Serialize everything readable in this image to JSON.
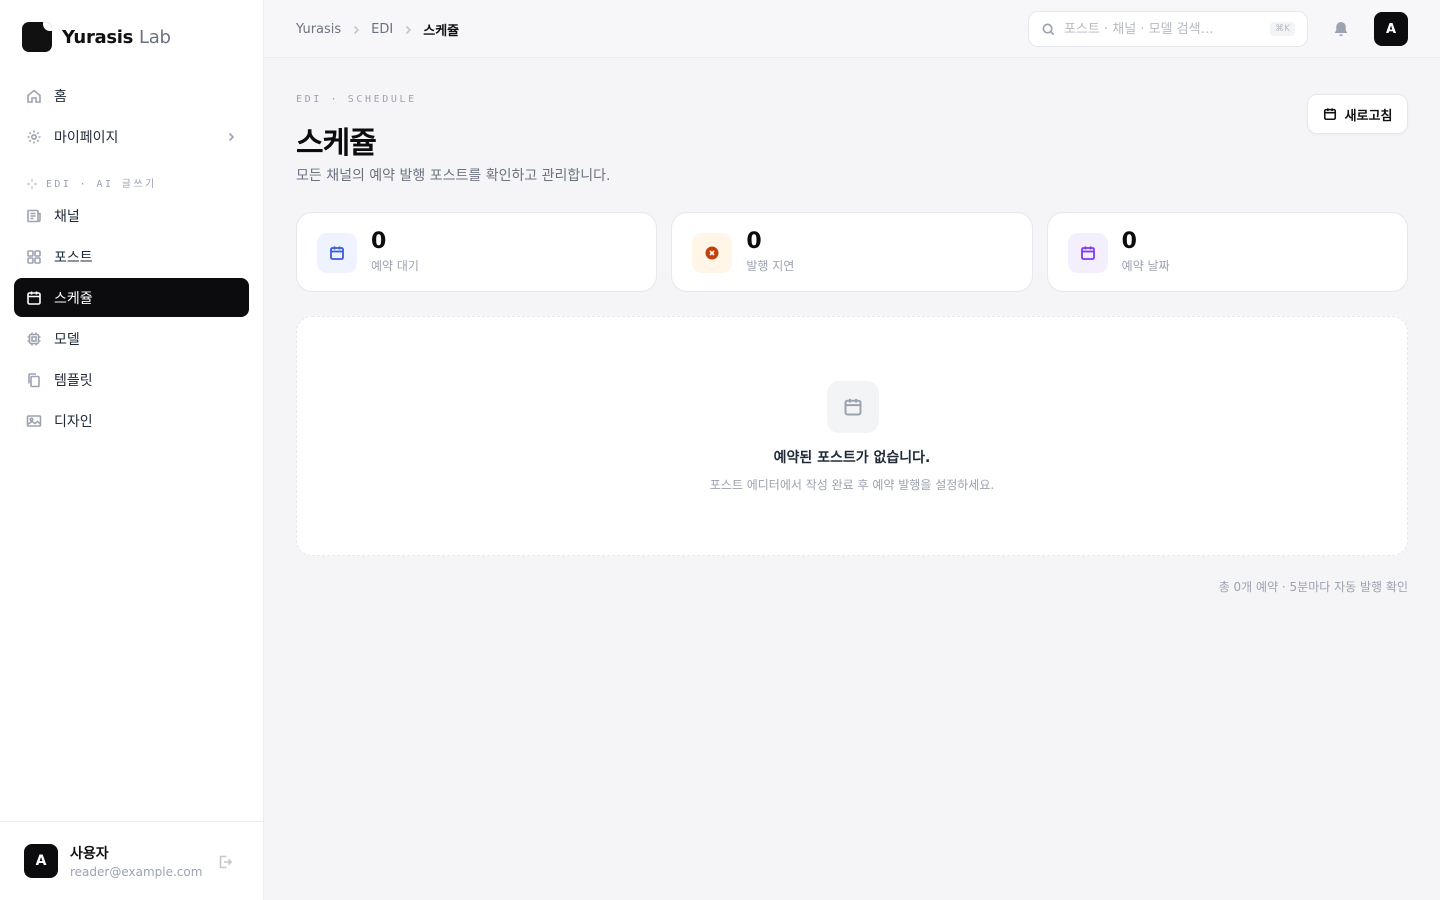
{
  "brand": {
    "name": "Yurasis",
    "name_light": "Lab"
  },
  "sidebar": {
    "items": [
      {
        "label": "홈",
        "icon": "home-icon"
      },
      {
        "label": "마이페이지",
        "icon": "gear-icon"
      }
    ],
    "section_label": "EDI · AI 글쓰기",
    "section_items": [
      {
        "label": "채널",
        "icon": "newspaper-icon"
      },
      {
        "label": "포스트",
        "icon": "grid-icon"
      },
      {
        "label": "스케쥴",
        "icon": "calendar-icon",
        "active": true
      },
      {
        "label": "모델",
        "icon": "chip-icon"
      },
      {
        "label": "템플릿",
        "icon": "copy-icon"
      },
      {
        "label": "디자인",
        "icon": "image-icon"
      }
    ]
  },
  "user": {
    "initial": "A",
    "name": "사용자",
    "email": "reader@example.com"
  },
  "topbar": {
    "breadcrumbs": [
      "Yurasis",
      "EDI",
      "스케쥴"
    ],
    "search_placeholder": "포스트 · 채널 · 모델 검색…",
    "search_shortcut": "⌘K",
    "avatar_initial": "A"
  },
  "page": {
    "eyebrow": "EDI · SCHEDULE",
    "title": "스케쥴",
    "subtitle": "모든 채널의 예약 발행 포스트를 확인하고 관리합니다.",
    "refresh_label": "새로고침"
  },
  "stats": [
    {
      "value": "0",
      "label": "예약 대기",
      "icon": "calendar-icon",
      "color": "#3b5bdb",
      "bg": "#eef3ff"
    },
    {
      "value": "0",
      "label": "발행 지연",
      "icon": "x-circle-icon",
      "color": "#c2410c",
      "bg": "#fff6e8"
    },
    {
      "value": "0",
      "label": "예약 날짜",
      "icon": "calendar-icon",
      "color": "#7c3aed",
      "bg": "#f4efff"
    }
  ],
  "empty": {
    "title": "예약된 포스트가 없습니다.",
    "description": "포스트 에디터에서 작성 완료 후 예약 발행을 설정하세요."
  },
  "footer_note": "총 0개 예약 · 5분마다 자동 발행 확인"
}
